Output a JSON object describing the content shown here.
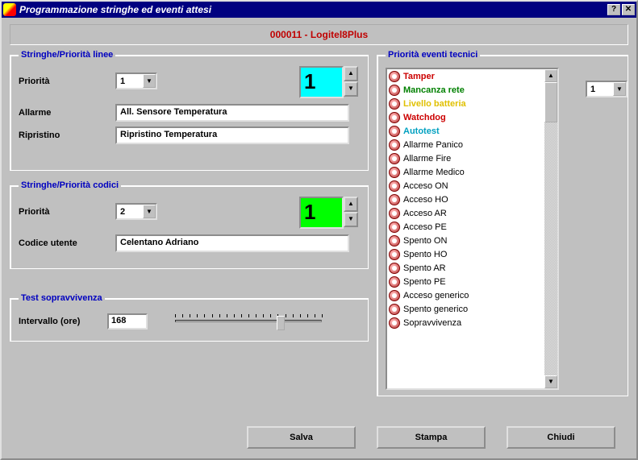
{
  "window": {
    "title": "Programmazione stringhe ed eventi attesi"
  },
  "header": {
    "text": "000011 - Logitel8Plus"
  },
  "linee": {
    "legend": "Stringhe/Priorità linee",
    "priorita_label": "Priorità",
    "priorita_value": "1",
    "display_value": "1",
    "allarme_label": "Allarme",
    "allarme_value": "All. Sensore Temperatura",
    "ripristino_label": "Ripristino",
    "ripristino_value": "Ripristino Temperatura"
  },
  "codici": {
    "legend": "Stringhe/Priorità codici",
    "priorita_label": "Priorità",
    "priorita_value": "2",
    "display_value": "1",
    "codice_label": "Codice utente",
    "codice_value": "Celentano Adriano"
  },
  "survival": {
    "legend": "Test sopravvivenza",
    "intervallo_label": "Intervallo (ore)",
    "intervallo_value": "168"
  },
  "eventi": {
    "legend": "Priorità eventi tecnici",
    "combo_value": "1",
    "items": [
      {
        "label": "Tamper",
        "cls": "li-red"
      },
      {
        "label": "Mancanza rete",
        "cls": "li-green"
      },
      {
        "label": "Livello batteria",
        "cls": "li-yellow"
      },
      {
        "label": "Watchdog",
        "cls": "li-red"
      },
      {
        "label": "Autotest",
        "cls": "li-cyan"
      },
      {
        "label": "Allarme Panico",
        "cls": "li-plain"
      },
      {
        "label": "Allarme Fire",
        "cls": "li-plain"
      },
      {
        "label": "Allarme Medico",
        "cls": "li-plain"
      },
      {
        "label": "Acceso ON",
        "cls": "li-plain"
      },
      {
        "label": "Acceso HO",
        "cls": "li-plain"
      },
      {
        "label": "Acceso AR",
        "cls": "li-plain"
      },
      {
        "label": "Acceso PE",
        "cls": "li-plain"
      },
      {
        "label": "Spento ON",
        "cls": "li-plain"
      },
      {
        "label": "Spento HO",
        "cls": "li-plain"
      },
      {
        "label": "Spento AR",
        "cls": "li-plain"
      },
      {
        "label": "Spento PE",
        "cls": "li-plain"
      },
      {
        "label": "Acceso generico",
        "cls": "li-plain"
      },
      {
        "label": "Spento generico",
        "cls": "li-plain"
      },
      {
        "label": "Sopravvivenza",
        "cls": "li-plain"
      }
    ]
  },
  "buttons": {
    "salva": "Salva",
    "stampa": "Stampa",
    "chiudi": "Chiudi"
  }
}
